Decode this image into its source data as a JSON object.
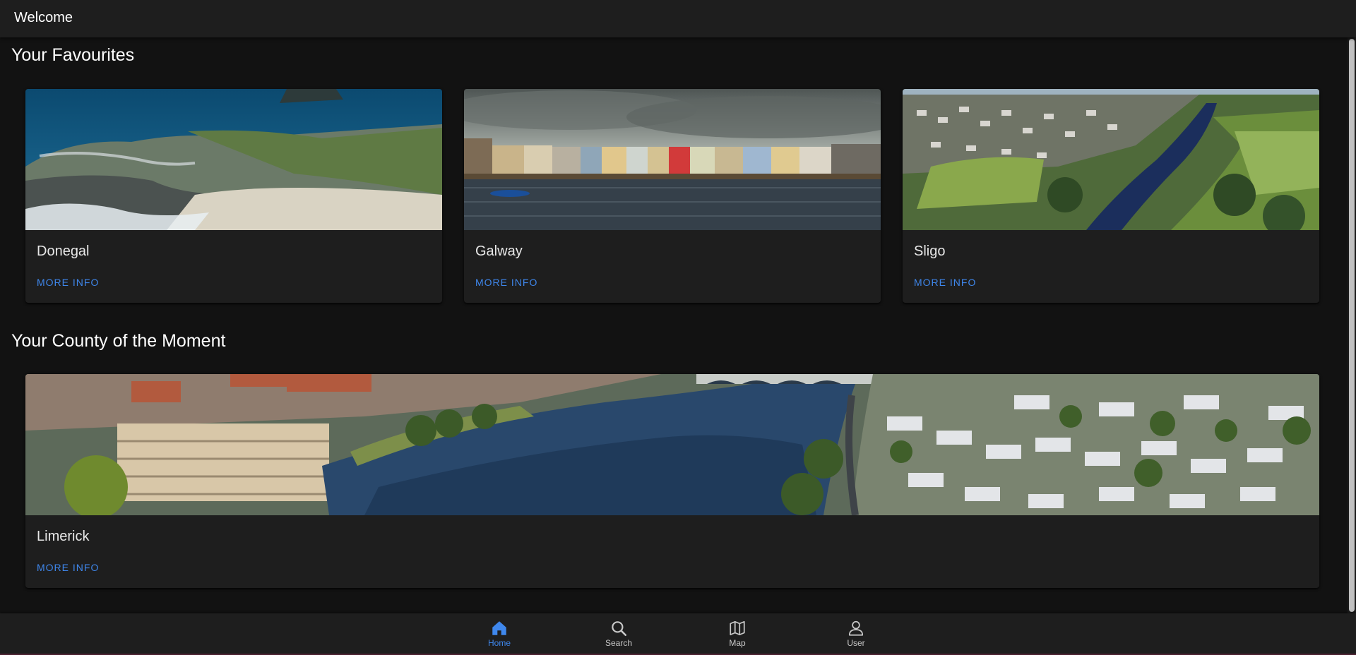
{
  "header": {
    "title": "Welcome"
  },
  "favourites": {
    "title": "Your Favourites",
    "cards": [
      {
        "name": "Donegal",
        "action": "MORE INFO",
        "image": "coastal-cliffs-beach-photo"
      },
      {
        "name": "Galway",
        "action": "MORE INFO",
        "image": "colourful-harbour-houses-photo"
      },
      {
        "name": "Sligo",
        "action": "MORE INFO",
        "image": "aerial-town-river-photo"
      }
    ]
  },
  "moment": {
    "title": "Your County of the Moment",
    "card": {
      "name": "Limerick",
      "action": "MORE INFO",
      "image": "aerial-city-river-bridge-photo"
    }
  },
  "nav": {
    "items": [
      {
        "label": "Home",
        "icon": "home-icon",
        "active": true
      },
      {
        "label": "Search",
        "icon": "search-icon",
        "active": false
      },
      {
        "label": "Map",
        "icon": "map-icon",
        "active": false
      },
      {
        "label": "User",
        "icon": "user-icon",
        "active": false
      }
    ]
  },
  "colors": {
    "accent": "#3f87ec",
    "background": "#121212",
    "surface": "#1e1e1e"
  }
}
